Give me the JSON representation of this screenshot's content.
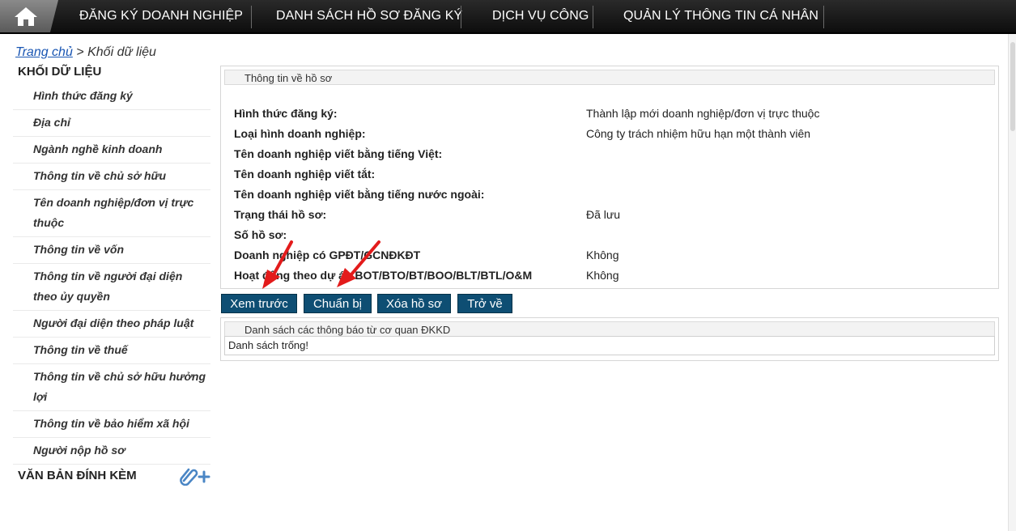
{
  "nav": {
    "home_icon": "home-icon",
    "items": [
      "ĐĂNG KÝ DOANH NGHIỆP",
      "DANH SÁCH HỒ SƠ ĐĂNG KÝ",
      "DỊCH VỤ CÔNG",
      "QUẢN LÝ THÔNG TIN CÁ NHÂN"
    ]
  },
  "breadcrumb": {
    "home": "Trang chủ",
    "separator": " > ",
    "current": "Khối dữ liệu"
  },
  "sidebar": {
    "heading": "KHỐI DỮ LIỆU",
    "items": [
      "Hình thức đăng ký",
      "Địa chỉ",
      "Ngành nghề kinh doanh",
      "Thông tin về chủ sở hữu",
      "Tên doanh nghiệp/đơn vị trực thuộc",
      "Thông tin về vốn",
      "Thông tin về người đại diện theo ủy quyền",
      "Người đại diện theo pháp luật",
      "Thông tin về thuế",
      "Thông tin về chủ sở hữu hưởng lợi",
      "Thông tin về bảo hiểm xã hội",
      "Người nộp hồ sơ"
    ],
    "attachments_heading": "VĂN BẢN ĐÍNH KÈM",
    "attachments_icon": "paperclip-add-icon"
  },
  "info_panel": {
    "title": "Thông tin về hồ sơ",
    "rows": [
      {
        "label": "Hình thức đăng ký:",
        "value": "Thành lập mới doanh nghiệp/đơn vị trực thuộc"
      },
      {
        "label": "Loại hình doanh nghiệp:",
        "value": "Công ty trách nhiệm hữu hạn một thành viên"
      },
      {
        "label": "Tên doanh nghiệp viết bằng tiếng Việt:",
        "value": ""
      },
      {
        "label": "Tên doanh nghiệp viết tắt:",
        "value": ""
      },
      {
        "label": "Tên doanh nghiệp viết bằng tiếng nước ngoài:",
        "value": ""
      },
      {
        "label": "Trạng thái hồ sơ:",
        "value": "Đã lưu"
      },
      {
        "label": "Số hồ sơ:",
        "value": ""
      },
      {
        "label": "Doanh nghiệp có GPĐT/GCNĐKĐT",
        "value": "Không"
      },
      {
        "label": "Hoạt động theo dự án BOT/BTO/BT/BOO/BLT/BTL/O&M",
        "value": "Không"
      }
    ]
  },
  "buttons": {
    "preview": "Xem trước",
    "prepare": "Chuẩn bị",
    "delete": "Xóa hồ sơ",
    "back": "Trở về"
  },
  "notice_panel": {
    "title": "Danh sách các thông báo từ cơ quan ĐKKD",
    "empty_text": "Danh sách trống!"
  },
  "colors": {
    "nav_bg": "#111111",
    "button_bg": "#0e4e73",
    "link": "#1a56b3",
    "annotation_arrow": "#e31b1b"
  }
}
